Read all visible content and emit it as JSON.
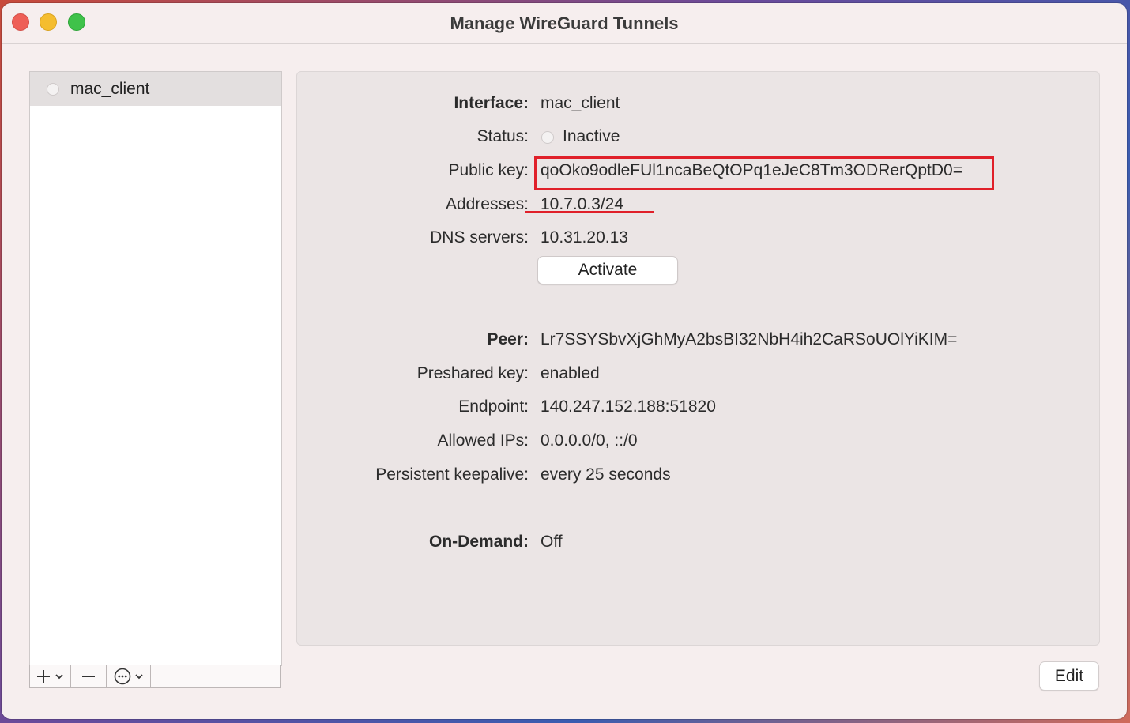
{
  "window": {
    "title": "Manage WireGuard Tunnels"
  },
  "sidebar": {
    "tunnels": [
      {
        "name": "mac_client",
        "status": "inactive"
      }
    ],
    "toolbar": {
      "add_icon": "plus-icon",
      "remove_icon": "minus-icon",
      "more_icon": "ellipsis-circle-icon"
    }
  },
  "interface": {
    "label": "Interface:",
    "value": "mac_client",
    "status_label": "Status:",
    "status_value": "Inactive",
    "public_key_label": "Public key:",
    "public_key": "qoOko9odleFUl1ncaBeQtOPq1eJeC8Tm3ODRerQptD0=",
    "addresses_label": "Addresses:",
    "addresses": "10.7.0.3/24",
    "dns_label": "DNS servers:",
    "dns": "10.31.20.13",
    "activate_label": "Activate"
  },
  "peer": {
    "label": "Peer:",
    "value": "Lr7SSYSbvXjGhMyA2bsBI32NbH4ih2CaRSoUOlYiKIM=",
    "preshared_label": "Preshared key:",
    "preshared": "enabled",
    "endpoint_label": "Endpoint:",
    "endpoint": "140.247.152.188:51820",
    "allowed_ips_label": "Allowed IPs:",
    "allowed_ips": "0.0.0.0/0, ::/0",
    "keepalive_label": "Persistent keepalive:",
    "keepalive": "every 25 seconds"
  },
  "on_demand": {
    "label": "On-Demand:",
    "value": "Off"
  },
  "footer": {
    "edit_label": "Edit"
  },
  "colors": {
    "highlight": "#e0202a",
    "window_bg": "#f6eeee",
    "panel_bg": "#ebe5e5"
  }
}
